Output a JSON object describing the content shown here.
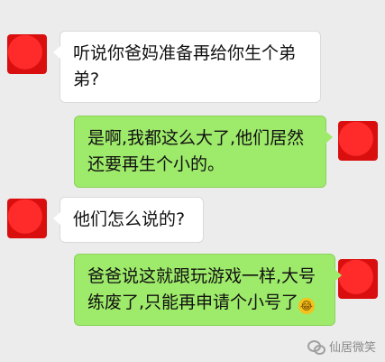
{
  "messages": [
    {
      "side": "left",
      "text": "听说你爸妈准备再给你生个弟弟?"
    },
    {
      "side": "right",
      "text": "是啊,我都这么大了,他们居然还要再生个小的。"
    },
    {
      "side": "left",
      "text": "他们怎么说的?"
    },
    {
      "side": "right",
      "text": "爸爸说这就跟玩游戏一样,大号练废了,只能再申请个小号了",
      "emoji": "😂"
    }
  ],
  "watermark": {
    "text": "仙居微笑",
    "icon": "wechat-icon"
  }
}
